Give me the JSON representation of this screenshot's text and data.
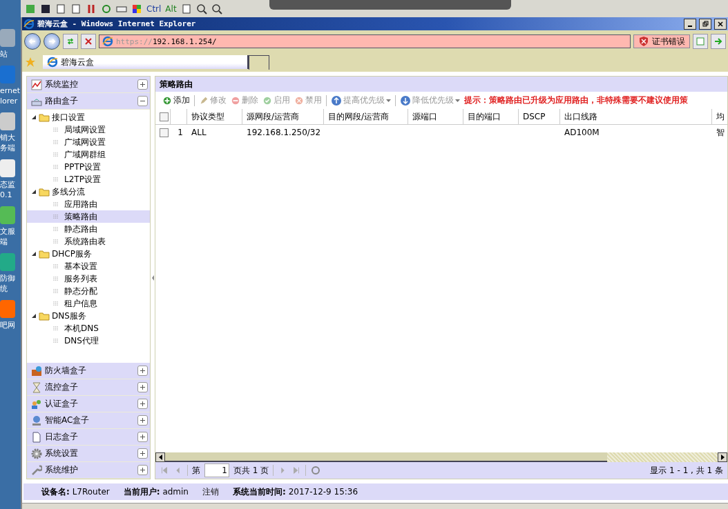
{
  "remote_toolbar": {
    "keys": [
      "Ctrl",
      "Alt"
    ]
  },
  "desktop": {
    "labels": [
      "站",
      "ernet",
      "lorer",
      "销大",
      "务端",
      "态监",
      "0.1",
      "文服",
      "端",
      "防御",
      "统",
      "吧网"
    ]
  },
  "browser": {
    "title": "碧海云盒 - Windows Internet Explorer",
    "address": {
      "scheme": "https://",
      "host": "192.168.1.254/"
    },
    "cert_error": "证书错误",
    "tab": "碧海云盒"
  },
  "sidebar": {
    "top_sections": [
      {
        "label": "系统监控",
        "expanded": false
      },
      {
        "label": "路由盒子",
        "expanded": true
      }
    ],
    "tree": [
      {
        "label": "接口设置",
        "expanded": true,
        "children": [
          {
            "label": "局域网设置",
            "selected": false
          },
          {
            "label": "广域网设置",
            "selected": false
          },
          {
            "label": "广域网群组",
            "selected": false
          },
          {
            "label": "PPTP设置",
            "selected": false
          },
          {
            "label": "L2TP设置",
            "selected": false
          }
        ]
      },
      {
        "label": "多线分流",
        "expanded": true,
        "children": [
          {
            "label": "应用路由",
            "selected": false
          },
          {
            "label": "策略路由",
            "selected": true
          },
          {
            "label": "静态路由",
            "selected": false
          },
          {
            "label": "系统路由表",
            "selected": false
          }
        ]
      },
      {
        "label": "DHCP服务",
        "expanded": true,
        "children": [
          {
            "label": "基本设置",
            "selected": false
          },
          {
            "label": "服务列表",
            "selected": false
          },
          {
            "label": "静态分配",
            "selected": false
          },
          {
            "label": "租户信息",
            "selected": false
          }
        ]
      },
      {
        "label": "DNS服务",
        "expanded": true,
        "children": [
          {
            "label": "本机DNS",
            "selected": false
          },
          {
            "label": "DNS代理",
            "selected": false
          }
        ]
      }
    ],
    "bottom_sections": [
      {
        "label": "防火墙盒子",
        "expanded": false
      },
      {
        "label": "流控盒子",
        "expanded": false
      },
      {
        "label": "认证盒子",
        "expanded": false
      },
      {
        "label": "智能AC盒子",
        "expanded": false
      },
      {
        "label": "日志盒子",
        "expanded": false
      },
      {
        "label": "系统设置",
        "expanded": false
      },
      {
        "label": "系统维护",
        "expanded": false
      }
    ]
  },
  "panel": {
    "title": "策略路由",
    "toolbar": [
      {
        "label": "添加",
        "kind": "add",
        "disabled": false
      },
      {
        "label": "修改",
        "kind": "edit",
        "disabled": true
      },
      {
        "label": "删除",
        "kind": "delete",
        "disabled": true
      },
      {
        "label": "启用",
        "kind": "enable",
        "disabled": true
      },
      {
        "label": "禁用",
        "kind": "disable",
        "disabled": true
      },
      {
        "label": "提高优先级",
        "kind": "up",
        "disabled": true
      },
      {
        "label": "降低优先级",
        "kind": "down",
        "disabled": true
      }
    ],
    "hint": "提示：策略路由已升级为应用路由，非特殊需要不建议使用策",
    "table": {
      "select_all_checked": false,
      "columns": [
        "协议类型",
        "源网段/运营商",
        "目的网段/运营商",
        "源端口",
        "目的端口",
        "DSCP",
        "出口线路",
        "均"
      ],
      "rows": [
        {
          "number": "1",
          "checked": false,
          "cells": [
            "ALL",
            "192.168.1.250/32",
            "",
            "",
            "",
            "",
            "AD100M",
            "智"
          ]
        }
      ]
    },
    "pager": {
      "prefix": "第",
      "page": "1",
      "suffix": "页共 1 页",
      "summary": "显示 1 - 1 , 共 1 条"
    }
  },
  "status_bar": [
    {
      "label": "设备名:",
      "value": "L7Router"
    },
    {
      "label": "当前用户:",
      "value": "admin",
      "link": "注销"
    },
    {
      "label": "系统当前时间:",
      "value": "2017-12-9 15:36"
    }
  ]
}
